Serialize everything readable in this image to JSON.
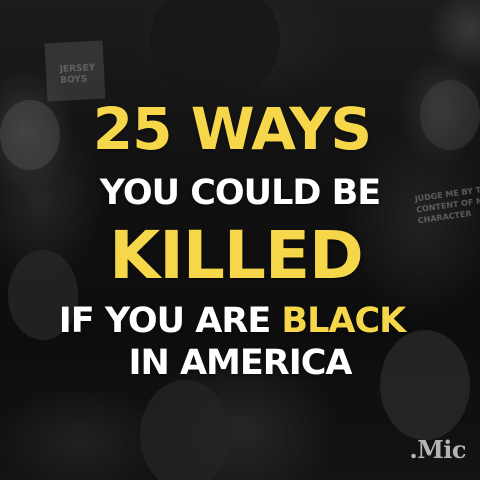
{
  "background": {
    "photo_description_icon": "crowd-protest-photo",
    "sign_text": "JERSEY\nBOYS",
    "shirt_text": "JUDGE ME BY THE\nCONTENT OF MY\nCHARACTER"
  },
  "headline": {
    "line1": "25 WAYS",
    "line2": "YOU COULD BE",
    "line3": "KILLED",
    "line4_prefix": "IF YOU ARE ",
    "line4_highlight": "BLACK",
    "line5": "IN AMERICA"
  },
  "colors": {
    "accent_yellow": "#f6d74a",
    "text_white": "#ffffff"
  },
  "logo": {
    "text": ".Mic"
  }
}
